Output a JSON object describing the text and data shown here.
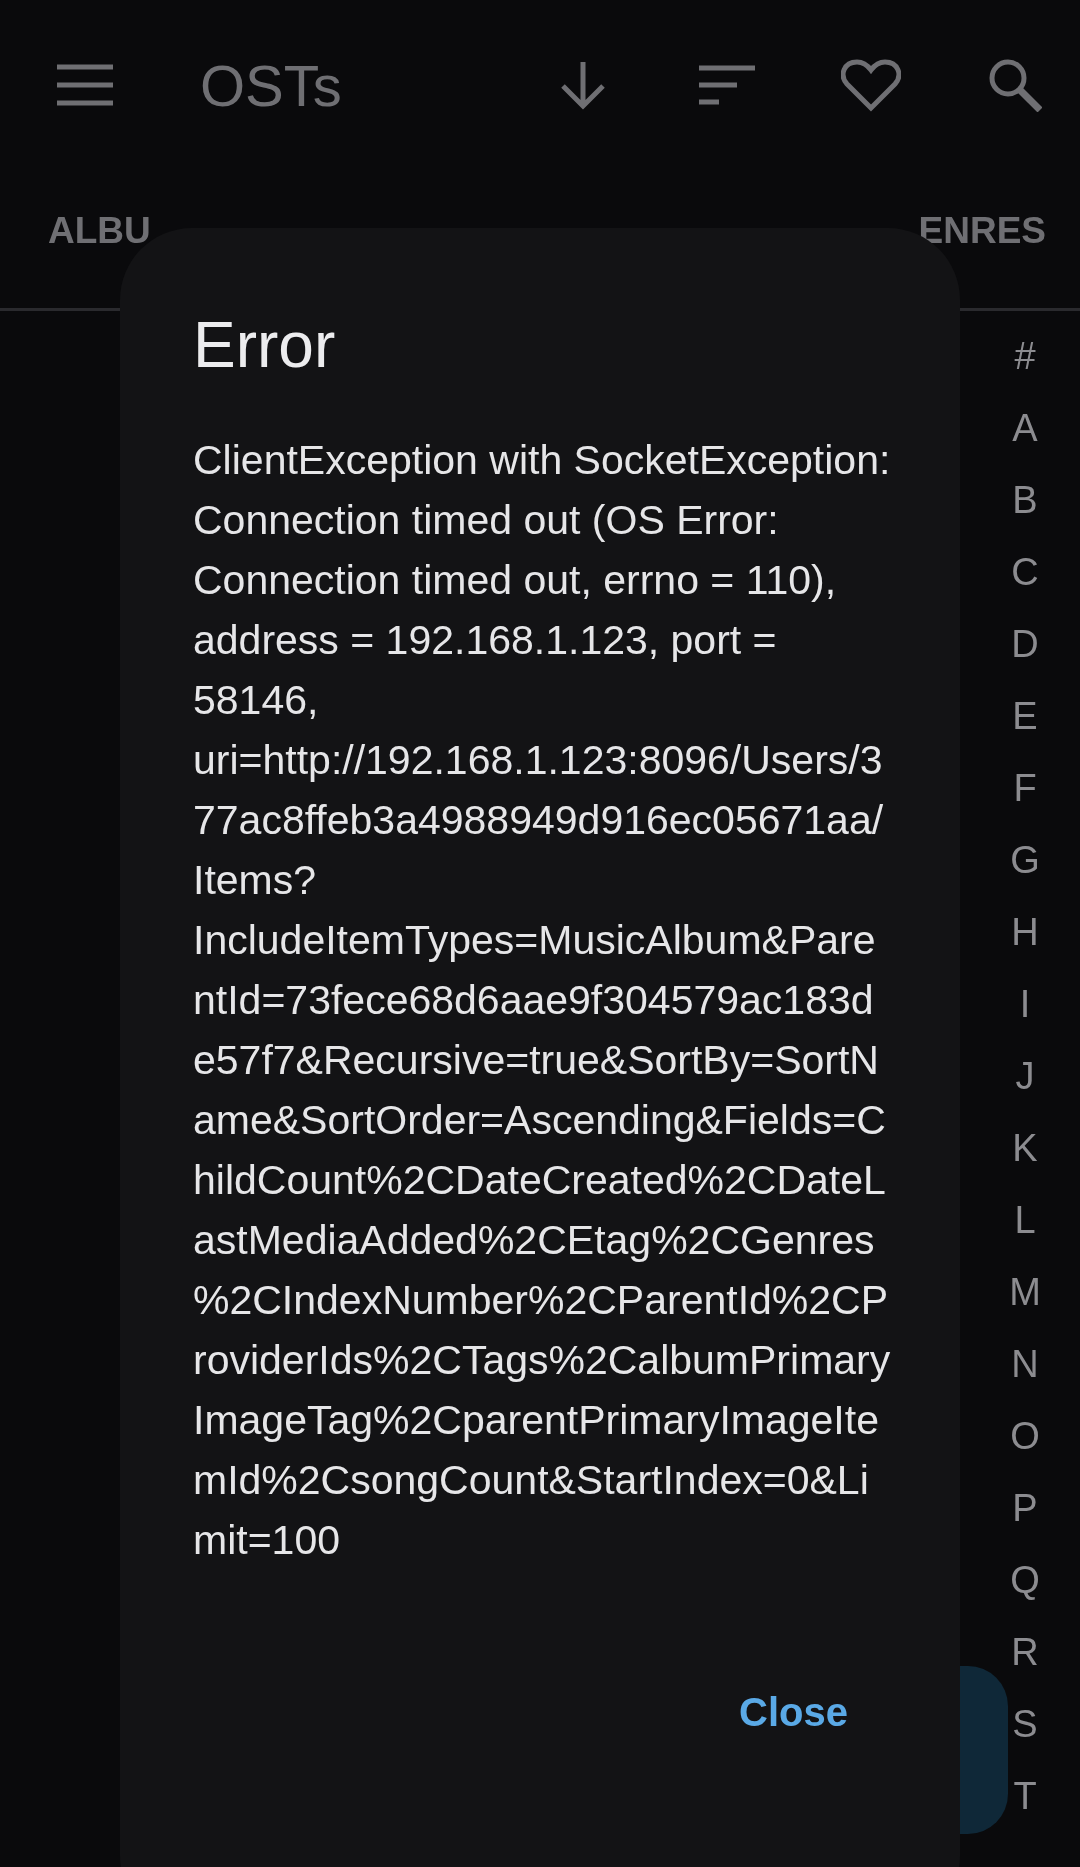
{
  "app_bar": {
    "title": "OSTs"
  },
  "tabs": [
    {
      "label": "ALBU"
    },
    {
      "label": "ENRES"
    }
  ],
  "index": [
    "#",
    "A",
    "B",
    "C",
    "D",
    "E",
    "F",
    "G",
    "H",
    "I",
    "J",
    "K",
    "L",
    "M",
    "N",
    "O",
    "P",
    "Q",
    "R",
    "S",
    "T"
  ],
  "dialog": {
    "title": "Error",
    "message": "ClientException with SocketException: Connection timed out (OS Error: Connection timed out, errno = 110), address = 192.168.1.123, port = 58146, uri=http://192.168.1.123:8096/Users/377ac8ffeb3a4988949d916ec05671aa/Items?IncludeItemTypes=MusicAlbum&ParentId=73fece68d6aae9f304579ac183de57f7&Recursive=true&SortBy=SortName&SortOrder=Ascending&Fields=ChildCount%2CDateCreated%2CDateLastMediaAdded%2CEtag%2CGenres%2CIndexNumber%2CParentId%2CProviderIds%2CTags%2CalbumPrimaryImageTag%2CparentPrimaryImageItemId%2CsongCount&StartIndex=0&Limit=100",
    "buttons": [
      "Close"
    ]
  }
}
